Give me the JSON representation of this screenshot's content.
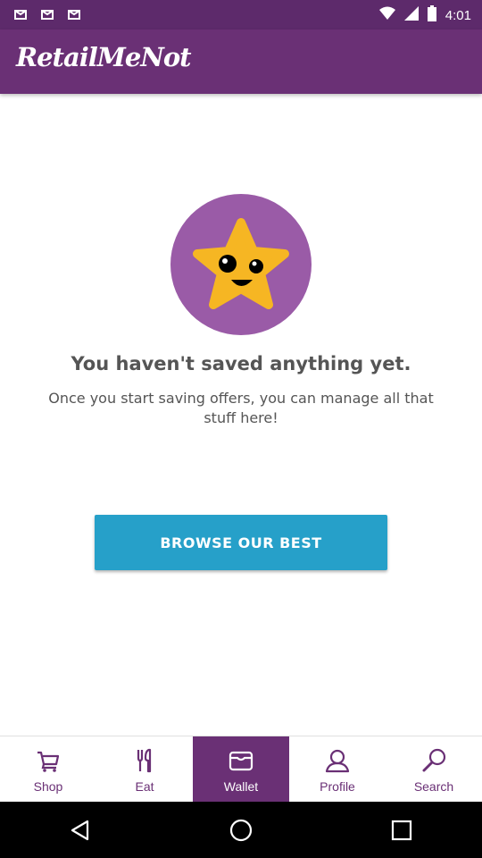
{
  "status_bar": {
    "time": "4:01"
  },
  "header": {
    "brand": "RetailMeNot"
  },
  "empty_state": {
    "title": "You haven't saved anything yet.",
    "subtitle": "Once you start saving offers, you can manage all that stuff here!",
    "cta_label": "BROWSE OUR BEST"
  },
  "bottom_nav": {
    "items": [
      {
        "label": "Shop",
        "icon": "cart-icon",
        "active": false
      },
      {
        "label": "Eat",
        "icon": "fork-knife-icon",
        "active": false
      },
      {
        "label": "Wallet",
        "icon": "wallet-icon",
        "active": true
      },
      {
        "label": "Profile",
        "icon": "person-icon",
        "active": false
      },
      {
        "label": "Search",
        "icon": "search-icon",
        "active": false
      }
    ]
  },
  "colors": {
    "brand_purple": "#6a3075",
    "accent_blue": "#26a0c9",
    "star_yellow": "#f6b623",
    "circle_purple": "#9a5ba7"
  }
}
